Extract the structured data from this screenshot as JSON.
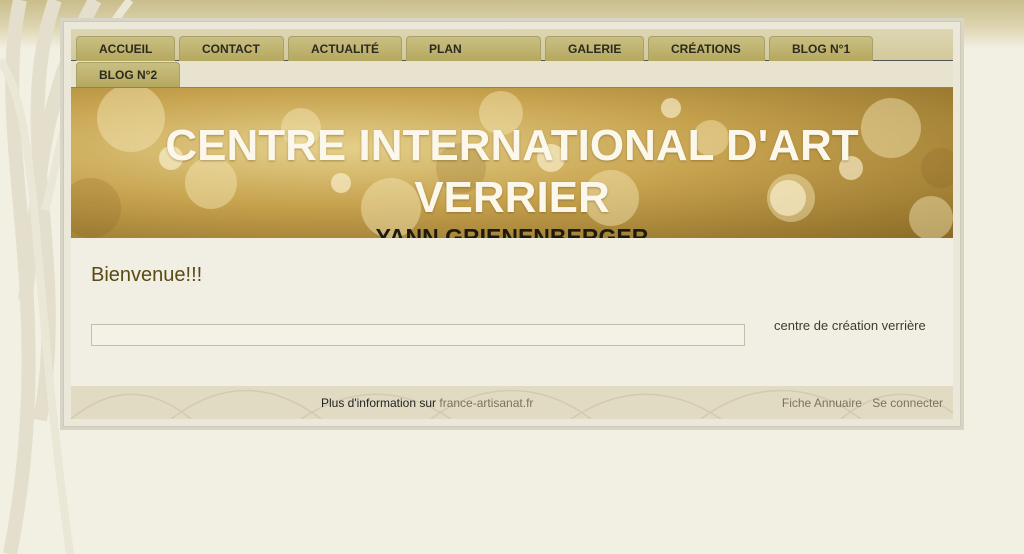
{
  "nav": {
    "tabs": [
      {
        "label": "ACCUEIL"
      },
      {
        "label": "CONTACT"
      },
      {
        "label": "ACTUALITÉ"
      },
      {
        "label": "PLAN"
      },
      {
        "label": "GALERIE"
      },
      {
        "label": "CRÉATIONS"
      },
      {
        "label": "BLOG N°1"
      },
      {
        "label": "BLOG N°2"
      }
    ]
  },
  "banner": {
    "title": "CENTRE INTERNATIONAL D'ART VERRIER",
    "subtitle": "YANN GRIENENBERGER"
  },
  "main": {
    "welcome": "Bienvenue!!!",
    "side_text": "centre de création verrière"
  },
  "footer": {
    "info_prefix": "Plus d'information sur",
    "info_link": "france-artisanat.fr",
    "annuaire": "Fiche Annuaire",
    "login": "Se connecter"
  },
  "colors": {
    "background": "#f2efe3",
    "tab": "#b5a85e",
    "welcome_text": "#5a4a14",
    "banner_title": "#fbf7ea"
  }
}
